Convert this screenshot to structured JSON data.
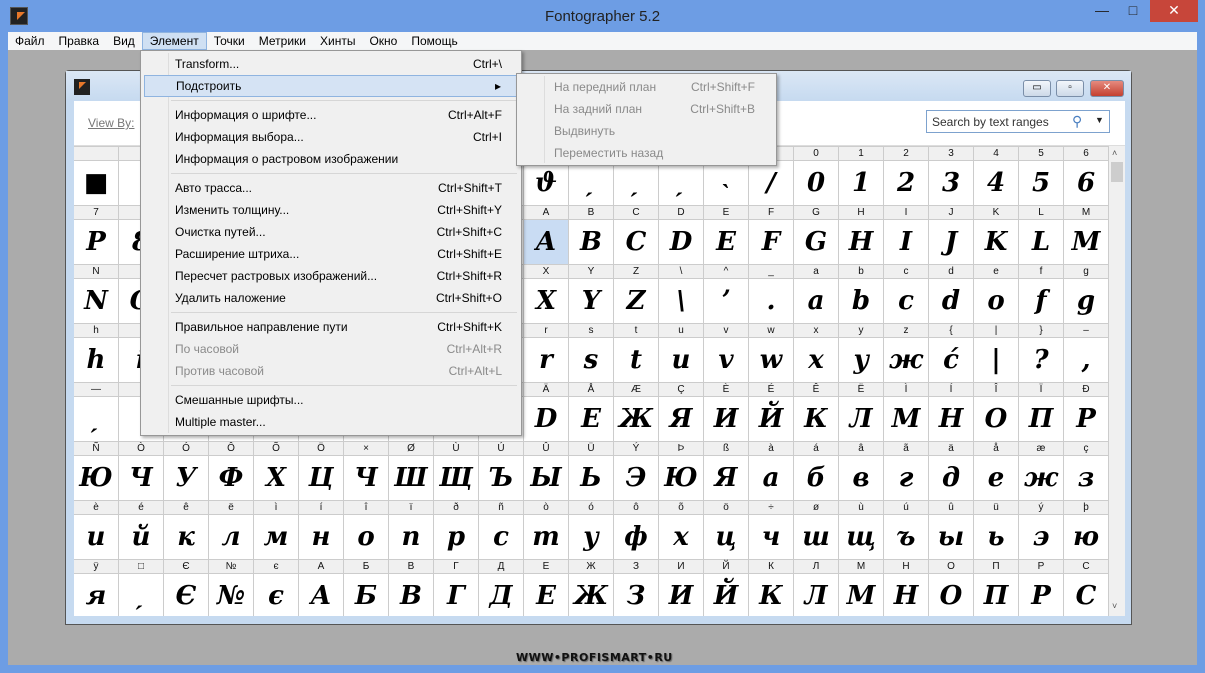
{
  "app": {
    "title": "Fontographer 5.2",
    "minimize": "—",
    "maximize": "□",
    "close": "✕"
  },
  "menubar": [
    "Файл",
    "Правка",
    "Вид",
    "Элемент",
    "Точки",
    "Метрики",
    "Хинты",
    "Окно",
    "Помощь"
  ],
  "active_menu": "Элемент",
  "child": {
    "view_by": "View By:",
    "search_placeholder": "Search by text ranges",
    "search_icon": "magnifier-icon",
    "minimize": "▭",
    "maximize": "▫",
    "close": "✕"
  },
  "menu": [
    {
      "label": "Transform...",
      "shortcut": "Ctrl+\\"
    },
    {
      "label": "Подстроить",
      "submenu": true,
      "highlight": true
    },
    {
      "sep": true
    },
    {
      "label": "Информация о шрифте...",
      "shortcut": "Ctrl+Alt+F"
    },
    {
      "label": "Информация выбора...",
      "shortcut": "Ctrl+I"
    },
    {
      "label": "Информация о растровом изображении",
      "shortcut": ""
    },
    {
      "sep": true
    },
    {
      "label": "Авто трасса...",
      "shortcut": "Ctrl+Shift+T"
    },
    {
      "label": "Изменить толщину...",
      "shortcut": "Ctrl+Shift+Y"
    },
    {
      "label": "Очистка путей...",
      "shortcut": "Ctrl+Shift+C"
    },
    {
      "label": "Расширение штриха...",
      "shortcut": "Ctrl+Shift+E"
    },
    {
      "label": "Пересчет растровых изображений...",
      "shortcut": "Ctrl+Shift+R"
    },
    {
      "label": "Удалить наложение",
      "shortcut": "Ctrl+Shift+O"
    },
    {
      "sep": true
    },
    {
      "label": "Правильное направление пути",
      "shortcut": "Ctrl+Shift+K"
    },
    {
      "label": "По часовой",
      "shortcut": "Ctrl+Alt+R",
      "disabled": true
    },
    {
      "label": "Против часовой",
      "shortcut": "Ctrl+Alt+L",
      "disabled": true
    },
    {
      "sep": true
    },
    {
      "label": "Смешанные шрифты...",
      "shortcut": ""
    },
    {
      "label": "Multiple master...",
      "shortcut": ""
    }
  ],
  "submenu": [
    {
      "label": "На передний план",
      "shortcut": "Ctrl+Shift+F"
    },
    {
      "label": "На задний план",
      "shortcut": "Ctrl+Shift+B"
    },
    {
      "label": "Выдвинуть",
      "shortcut": ""
    },
    {
      "label": "Переместить назад",
      "shortcut": ""
    }
  ],
  "grid": {
    "selected": {
      "row": 1,
      "col": 10
    },
    "rows": [
      {
        "labels": [
          "",
          "",
          "",
          "",
          "",
          "",
          "",
          "",
          "",
          "",
          "",
          "",
          "",
          "",
          "",
          "",
          "0",
          "1",
          "2",
          "3",
          "4",
          "5",
          "6"
        ],
        "glyphs": [
          "■",
          "",
          "",
          "",
          "",
          "",
          "",
          "",
          "",
          "",
          "ϑ",
          "ˏ",
          "ˏ",
          "ˏ",
          "˴",
          "/",
          "0",
          "1",
          "2",
          "3",
          "4",
          "5",
          "6"
        ]
      },
      {
        "labels": [
          "7",
          "",
          "",
          "",
          "",
          "",
          "",
          "",
          "",
          "",
          "A",
          "B",
          "C",
          "D",
          "E",
          "F",
          "G",
          "H",
          "I",
          "J",
          "K",
          "L",
          "M"
        ],
        "glyphs": [
          "P",
          "8",
          "",
          "",
          "",
          "",
          "",
          "",
          "",
          "",
          "A",
          "B",
          "C",
          "D",
          "E",
          "F",
          "G",
          "H",
          "I",
          "J",
          "K",
          "L",
          "M"
        ]
      },
      {
        "labels": [
          "N",
          "",
          "",
          "",
          "",
          "",
          "",
          "",
          "",
          "",
          "X",
          "Y",
          "Z",
          "\\",
          "^",
          "_",
          "a",
          "b",
          "c",
          "d",
          "e",
          "f",
          "g"
        ],
        "glyphs": [
          "N",
          "O",
          "",
          "",
          "",
          "",
          "",
          "",
          "",
          "",
          "X",
          "Y",
          "Z",
          "\\",
          "ʼ",
          ".",
          "a",
          "b",
          "c",
          "d",
          "o",
          "f",
          "g"
        ]
      },
      {
        "labels": [
          "h",
          "",
          "",
          "",
          "",
          "",
          "",
          "",
          "",
          "",
          "r",
          "s",
          "t",
          "u",
          "v",
          "w",
          "x",
          "y",
          "z",
          "{",
          "|",
          "}",
          "–"
        ],
        "glyphs": [
          "h",
          "i",
          "",
          "",
          "",
          "",
          "",
          "",
          "",
          "",
          "r",
          "s",
          "t",
          "u",
          "v",
          "w",
          "x",
          "y",
          "ж",
          "ć",
          "|",
          "?",
          ","
        ]
      },
      {
        "labels": [
          "—",
          "",
          "",
          "",
          "",
          "",
          "",
          "",
          "",
          "",
          "Ä",
          "Å",
          "Æ",
          "Ç",
          "È",
          "É",
          "Ê",
          "Ë",
          "Ì",
          "Í",
          "Î",
          "Ï",
          "Ð"
        ],
        "glyphs": [
          "ˏ",
          "",
          "",
          "",
          "",
          "",
          "",
          "",
          "",
          "",
          "D",
          "Е",
          "Ж",
          "Я",
          "И",
          "Й",
          "К",
          "Л",
          "М",
          "Н",
          "О",
          "П",
          "Р"
        ]
      },
      {
        "labels": [
          "Ñ",
          "Ò",
          "Ó",
          "Ô",
          "Õ",
          "Ö",
          "×",
          "Ø",
          "Ù",
          "Ú",
          "Û",
          "Ü",
          "Ý",
          "Þ",
          "ß",
          "à",
          "á",
          "â",
          "ã",
          "ä",
          "å",
          "æ",
          "ç"
        ],
        "glyphs": [
          "Ю",
          "Ч",
          "У",
          "Ф",
          "Х",
          "Ц",
          "Ч",
          "Ш",
          "Щ",
          "Ъ",
          "Ы",
          "Ь",
          "Э",
          "Ю",
          "Я",
          "а",
          "б",
          "в",
          "г",
          "д",
          "е",
          "ж",
          "з"
        ]
      },
      {
        "labels": [
          "è",
          "é",
          "ê",
          "ë",
          "ì",
          "í",
          "î",
          "ï",
          "ð",
          "ñ",
          "ò",
          "ó",
          "ô",
          "õ",
          "ö",
          "÷",
          "ø",
          "ù",
          "ú",
          "û",
          "ü",
          "ý",
          "þ"
        ],
        "glyphs": [
          "и",
          "й",
          "к",
          "л",
          "м",
          "н",
          "о",
          "п",
          "р",
          "с",
          "т",
          "у",
          "ф",
          "х",
          "ц",
          "ч",
          "ш",
          "щ",
          "ъ",
          "ы",
          "ь",
          "э",
          "ю"
        ]
      },
      {
        "labels": [
          "ÿ",
          "□",
          "Є",
          "№",
          "є",
          "А",
          "Б",
          "В",
          "Г",
          "Д",
          "Е",
          "Ж",
          "З",
          "И",
          "Й",
          "К",
          "Л",
          "М",
          "Н",
          "О",
          "П",
          "Р",
          "С"
        ],
        "glyphs": [
          "я",
          "ˏ",
          "Є",
          "№",
          "є",
          "А",
          "Б",
          "В",
          "Г",
          "Д",
          "Е",
          "Ж",
          "З",
          "И",
          "Й",
          "К",
          "Л",
          "М",
          "Н",
          "О",
          "П",
          "Р",
          "С"
        ]
      }
    ]
  },
  "watermark": "WWW•PROFISMART•RU"
}
